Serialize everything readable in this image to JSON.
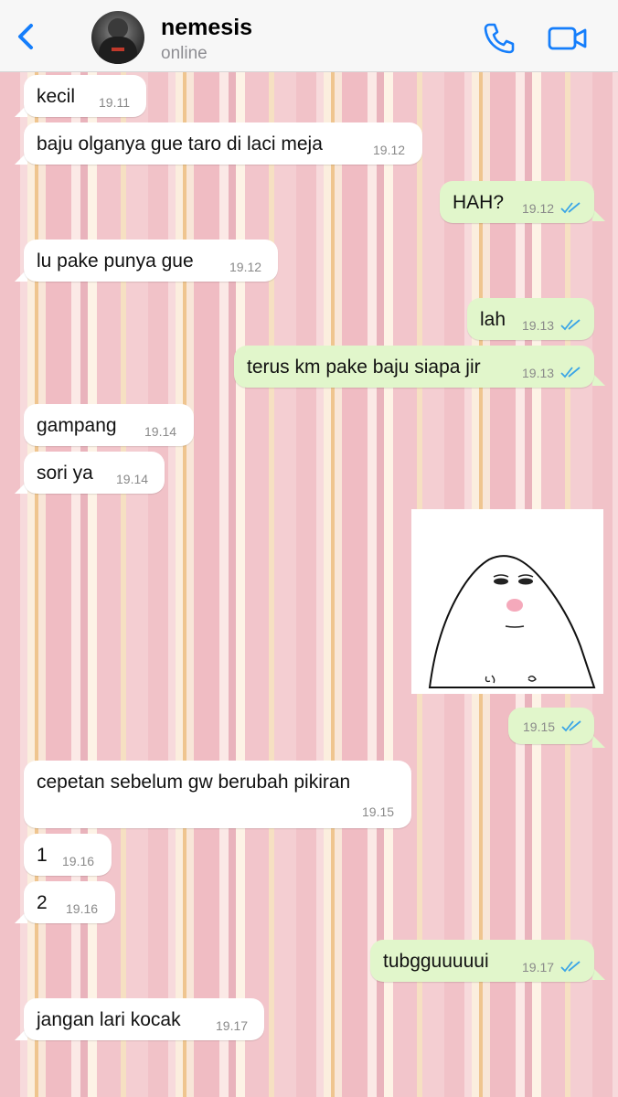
{
  "header": {
    "contact_name": "nemesis",
    "status": "online"
  },
  "colors": {
    "accent": "#157efb",
    "incoming_bubble": "#ffffff",
    "outgoing_bubble": "#e1f6cb",
    "read_ticks": "#3ba5e6"
  },
  "messages": [
    {
      "dir": "in",
      "text": "kecil",
      "time": "19.11"
    },
    {
      "dir": "in",
      "text": "baju olganya gue taro di laci meja",
      "time": "19.12"
    },
    {
      "dir": "out",
      "text": "HAH?",
      "time": "19.12"
    },
    {
      "dir": "in",
      "text": "lu pake punya gue",
      "time": "19.12"
    },
    {
      "dir": "out",
      "text": "lah",
      "time": "19.13"
    },
    {
      "dir": "out",
      "text": "terus km pake baju siapa jir",
      "time": "19.13"
    },
    {
      "dir": "in",
      "text": "gampang",
      "time": "19.14"
    },
    {
      "dir": "in",
      "text": "sori ya",
      "time": "19.14"
    },
    {
      "dir": "out",
      "type": "sticker",
      "sticker": "blob-face-sticker",
      "time": "19.15"
    },
    {
      "dir": "in",
      "text": "cepetan sebelum gw berubah pikiran",
      "time": "19.15"
    },
    {
      "dir": "in",
      "text": "1",
      "time": "19.16"
    },
    {
      "dir": "in",
      "text": "2",
      "time": "19.16"
    },
    {
      "dir": "out",
      "text": "tubgguuuuui",
      "time": "19.17"
    },
    {
      "dir": "in",
      "text": "jangan lari kocak",
      "time": "19.17"
    }
  ]
}
